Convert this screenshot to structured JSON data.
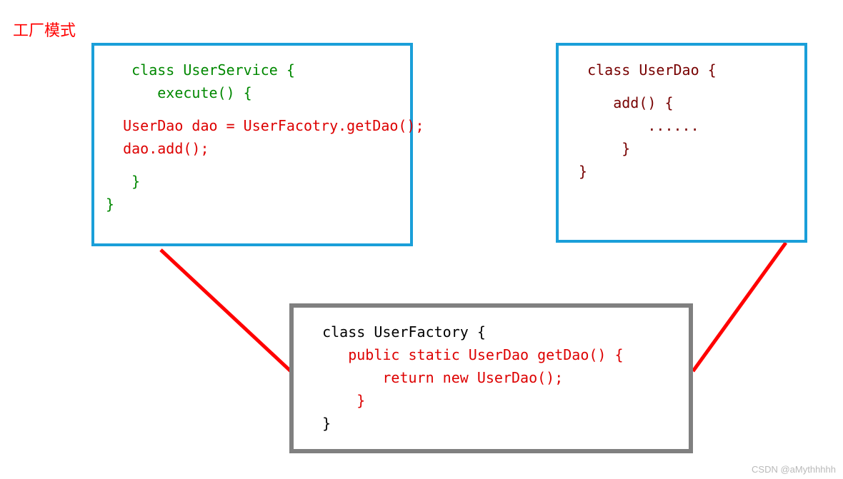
{
  "title": "工厂模式",
  "userservice": {
    "l1": "   class UserService {",
    "l2": "      execute() {",
    "l3": "  UserDao dao = UserFacotry.getDao();",
    "l4": "  dao.add();",
    "l5": "   }",
    "l6": "}"
  },
  "userdao": {
    "l1": "  class UserDao {",
    "l2": "     add() {",
    "l3": "         ......",
    "l4": "      }",
    "l5": " }"
  },
  "userfactory": {
    "l1": "  class UserFactory {",
    "l2": "     public static UserDao getDao() {",
    "l3": "         return new UserDao();",
    "l4": "      }",
    "l5": "  }"
  },
  "attribution": "CSDN @aMythhhhh"
}
